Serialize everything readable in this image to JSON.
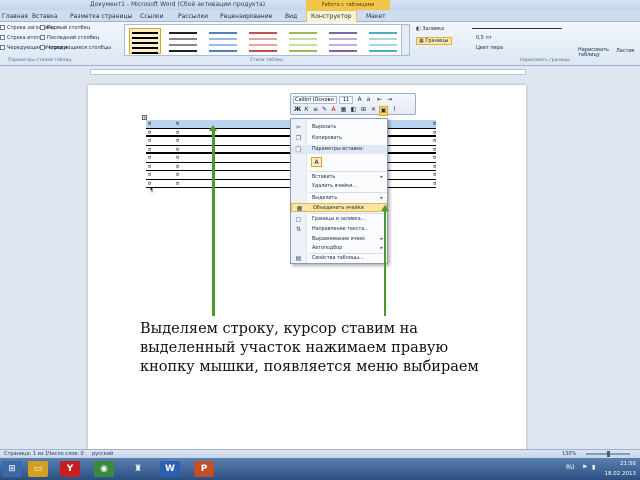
{
  "window": {
    "doc_title": "Документ1 - Microsoft Word (Сбой активации продукта)",
    "context_tab_title": "Работа с таблицами"
  },
  "ribbon_tabs": [
    "Главная",
    "Вставка",
    "Разметка страницы",
    "Ссылки",
    "Рассылки",
    "Рецензирование",
    "Вид",
    "Конструктор",
    "Макет"
  ],
  "ribbon": {
    "options_left": [
      "Строка заголовка",
      "Строка итогов",
      "Чередующиеся строки"
    ],
    "options_right": [
      "Первый столбец",
      "Последний столбец",
      "Чередующиеся столбцы"
    ],
    "group_options_label": "Параметры стилей таблиц",
    "group_styles_label": "Стили таблиц",
    "group_borders_label": "Нарисовать границы",
    "shading_label": "Заливка",
    "borders_label": "Границы",
    "pen_weight": "0,5 пт",
    "pen_color": "Цвет пера",
    "draw_table": "Нарисовать таблицу",
    "eraser": "Ластик"
  },
  "mini_toolbar": {
    "font": "Calibri (Основн",
    "size": "11"
  },
  "context_menu": {
    "items": [
      {
        "icon": "scissors-icon",
        "glyph": "✂",
        "label": "Вырезать",
        "arrow": ""
      },
      {
        "icon": "copy-icon",
        "glyph": "❐",
        "label": "Копировать",
        "arrow": ""
      },
      {
        "icon": "paste-icon",
        "glyph": "📋",
        "label": "Параметры вставки:",
        "arrow": ""
      },
      {
        "icon": "",
        "glyph": "",
        "label": "Вставить",
        "arrow": "▸"
      },
      {
        "icon": "",
        "glyph": "",
        "label": "Удалить ячейки...",
        "arrow": ""
      },
      {
        "icon": "",
        "glyph": "",
        "label": "Выделить",
        "arrow": "▸"
      },
      {
        "icon": "merge-icon",
        "glyph": "▦",
        "label": "Объединить ячейки",
        "arrow": ""
      },
      {
        "icon": "borders-icon",
        "glyph": "▢",
        "label": "Границы и заливка...",
        "arrow": ""
      },
      {
        "icon": "text-direction-icon",
        "glyph": "⇅",
        "label": "Направление текста...",
        "arrow": ""
      },
      {
        "icon": "",
        "glyph": "",
        "label": "Выравнивание ячеек",
        "arrow": "▸"
      },
      {
        "icon": "",
        "glyph": "",
        "label": "Автоподбор",
        "arrow": "▸"
      },
      {
        "icon": "table-props-icon",
        "glyph": "▤",
        "label": "Свойства таблицы...",
        "arrow": ""
      }
    ]
  },
  "caption": "Выделяем строку, курсор ставим на выделенный участок нажимаем правую кнопку мышки, появляется меню выбираем",
  "status": {
    "page": "Страница: 1 из 1",
    "words": "Число слов: 0",
    "lang": "русский",
    "zoom": "130%"
  },
  "taskbar": {
    "time": "21:56",
    "date": "18.02.2013",
    "lang": "RU"
  },
  "colors": {
    "arrow": "#4a9a2e",
    "selection": "#b9d3f0",
    "highlight": "#fbe5a3"
  }
}
